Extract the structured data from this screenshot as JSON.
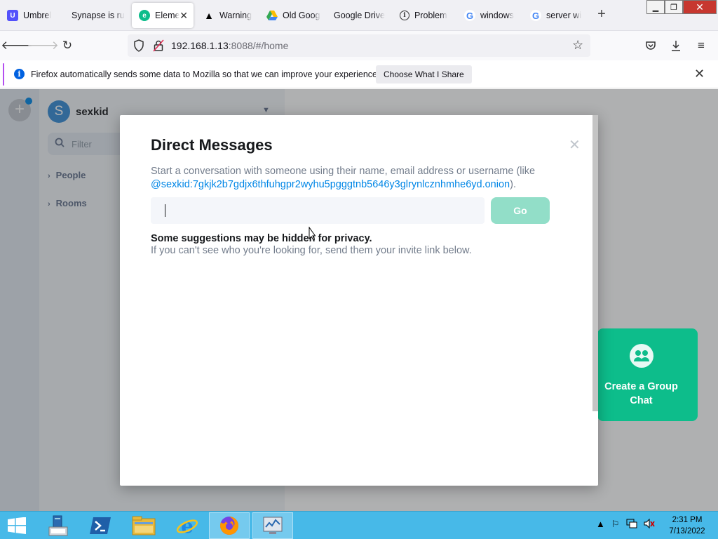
{
  "browser": {
    "tabs": [
      {
        "title": "Umbrel",
        "favicon_color": "#5351fb",
        "icon": "umbrel-icon"
      },
      {
        "title": "Synapse is ru",
        "favicon_color": "",
        "icon": ""
      },
      {
        "title": "Elemen",
        "favicon_color": "#0dbd8b",
        "icon": "element-icon",
        "active": true
      },
      {
        "title": "Warning",
        "favicon_color": "#000000",
        "icon": "warning-icon"
      },
      {
        "title": "Old Goog",
        "favicon_color": "#34a853",
        "icon": "drive-icon"
      },
      {
        "title": "Google Drive",
        "favicon_color": "",
        "icon": ""
      },
      {
        "title": "Problem",
        "favicon_color": "#333333",
        "icon": "info-circle-icon"
      },
      {
        "title": "windows",
        "favicon_color": "#4285f4",
        "icon": "google-icon"
      },
      {
        "title": "server wi",
        "favicon_color": "#4285f4",
        "icon": "google-icon"
      }
    ],
    "url_host": "192.168.1.13",
    "url_rest": ":8088/#/home"
  },
  "infobar": {
    "message": "Firefox automatically sends some data to Mozilla so that we can improve your experience.",
    "button": "Choose What I Share"
  },
  "element": {
    "user_initial": "S",
    "user_name": "sexkid",
    "filter_placeholder": "Filter",
    "sections": [
      "People",
      "Rooms"
    ],
    "group_chat_label": "Create a Group Chat"
  },
  "dialog": {
    "title": "Direct Messages",
    "description_prefix": "Start a conversation with someone using their name, email address or username (like ",
    "example_user": "@sexkid:7gkjk2b7gdjx6thfuhgpr2wyhu5pgggtnb5646y3glrynlcznhmhe6yd.onion",
    "description_suffix": ").",
    "go_button": "Go",
    "hint_title": "Some suggestions may be hidden for privacy.",
    "hint_body": "If you can't see who you're looking for, send them your invite link below."
  },
  "taskbar": {
    "time": "2:31 PM",
    "date": "7/13/2022"
  }
}
